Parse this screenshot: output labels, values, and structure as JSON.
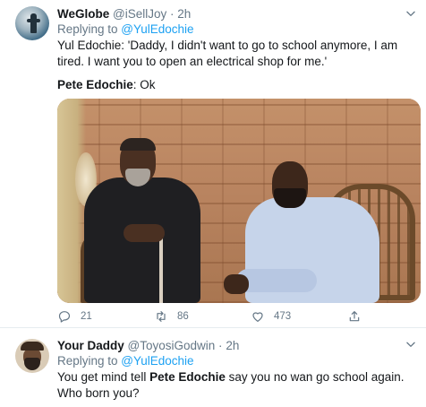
{
  "tweets": [
    {
      "name": "WeGlobe",
      "handle": "@iSellJoy",
      "dot": "·",
      "time": "2h",
      "replying_prefix": "Replying to ",
      "replying_to": "@YulEdochie",
      "line1": "Yul Edochie: 'Daddy, I didn't want to go to school anymore, I am tired. I want you to open an electrical shop for me.'",
      "line2_bold": "Pete Edochie",
      "line2_rest": ": Ok",
      "actions": {
        "reply_count": "21",
        "retweet_count": "86",
        "like_count": "473"
      }
    },
    {
      "name": "Your Daddy",
      "handle": "@ToyosiGodwin",
      "dot": "·",
      "time": "2h",
      "replying_prefix": "Replying to ",
      "replying_to": "@YulEdochie",
      "text_before": "You get mind tell ",
      "text_bold": "Pete Edochie",
      "text_after": " say you no wan go school again. Who born you?"
    }
  ],
  "icons": [
    "reply-icon",
    "retweet-icon",
    "like-icon",
    "share-icon",
    "chevron-down-icon"
  ],
  "colors": {
    "accent": "#1da1f2",
    "secondary_text": "#657786",
    "primary_text": "#14171a",
    "divider": "#e6ecf0"
  }
}
